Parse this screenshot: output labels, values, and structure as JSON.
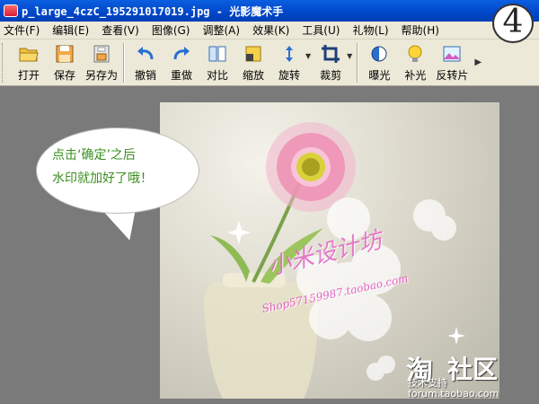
{
  "window": {
    "title": "p_large_4czC_195291017019.jpg - 光影魔术手",
    "step_number": "4"
  },
  "menu": [
    "文件(F)",
    "编辑(E)",
    "查看(V)",
    "图像(G)",
    "调整(A)",
    "效果(K)",
    "工具(U)",
    "礼物(L)",
    "帮助(H)"
  ],
  "toolbar": {
    "open": "打开",
    "save": "保存",
    "save_as": "另存为",
    "undo": "撤销",
    "redo": "重做",
    "compare": "对比",
    "zoom": "缩放",
    "rotate": "旋转",
    "crop": "裁剪",
    "exposure": "曝光",
    "fill_light": "补光",
    "invert": "反转片"
  },
  "callout": {
    "line1": "点击‘确定’之后",
    "line2": "水印就加好了哦！"
  },
  "watermark": {
    "brand": "小米设计坊",
    "shop_url": "Shop57159987.taobao.com"
  },
  "forum_logo": {
    "glyph": "淘",
    "name": "社区",
    "line1": "技术支持",
    "line2": "forum.taobao.com"
  },
  "colors": {
    "title_bar": "#0046c8",
    "chrome": "#ece9d8",
    "workspace": "#7a7a7a",
    "callout_text": "#3a8f1f",
    "watermark_pink": "#e66cc8"
  }
}
